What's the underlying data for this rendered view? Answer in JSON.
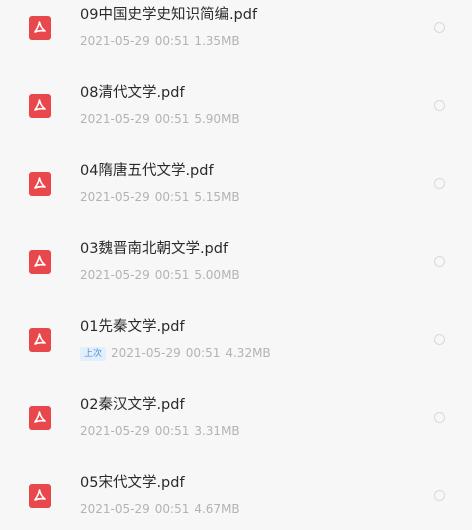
{
  "files": [
    {
      "name": "09中国史学史知识简编.pdf",
      "date": "2021-05-29",
      "time": "00:51",
      "size": "1.35MB",
      "badge": ""
    },
    {
      "name": "08清代文学.pdf",
      "date": "2021-05-29",
      "time": "00:51",
      "size": "5.90MB",
      "badge": ""
    },
    {
      "name": "04隋唐五代文学.pdf",
      "date": "2021-05-29",
      "time": "00:51",
      "size": "5.15MB",
      "badge": ""
    },
    {
      "name": "03魏晋南北朝文学.pdf",
      "date": "2021-05-29",
      "time": "00:51",
      "size": "5.00MB",
      "badge": ""
    },
    {
      "name": "01先秦文学.pdf",
      "date": "2021-05-29",
      "time": "00:51",
      "size": "4.32MB",
      "badge": "上次"
    },
    {
      "name": "02秦汉文学.pdf",
      "date": "2021-05-29",
      "time": "00:51",
      "size": "3.31MB",
      "badge": ""
    },
    {
      "name": "05宋代文学.pdf",
      "date": "2021-05-29",
      "time": "00:51",
      "size": "4.67MB",
      "badge": ""
    }
  ],
  "colors": {
    "pdf_icon": "#e8474b",
    "badge_text": "#4a90d9",
    "badge_bg": "#e3f0fb"
  },
  "icons": {
    "file_type": "pdf-file-icon",
    "select": "radio-circle-icon"
  }
}
